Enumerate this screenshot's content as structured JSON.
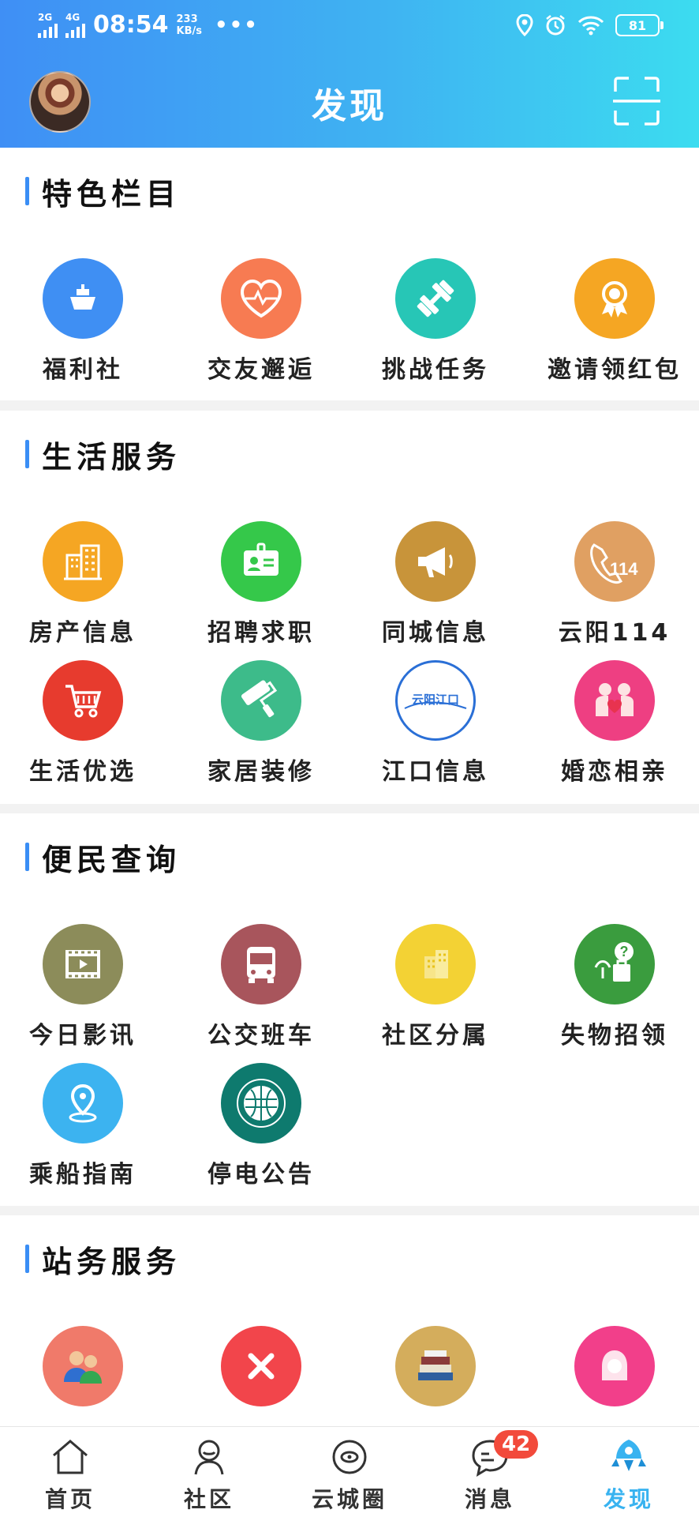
{
  "status_bar": {
    "net1": "2G",
    "net2": "4G",
    "time": "08:54",
    "speed_value": "233",
    "speed_unit": "KB/s",
    "battery": "81"
  },
  "header": {
    "title": "发现"
  },
  "sections": [
    {
      "title": "特色栏目",
      "items": [
        {
          "label": "福利社",
          "icon": "ship-icon",
          "color": "#3f8ff3"
        },
        {
          "label": "交友邂逅",
          "icon": "heartbeat-icon",
          "color": "#f77b52"
        },
        {
          "label": "挑战任务",
          "icon": "dumbbell-icon",
          "color": "#27c6b6"
        },
        {
          "label": "邀请领红包",
          "icon": "medal-icon",
          "color": "#f5a623"
        }
      ]
    },
    {
      "title": "生活服务",
      "items": [
        {
          "label": "房产信息",
          "icon": "building-icon",
          "color": "#f5a623"
        },
        {
          "label": "招聘求职",
          "icon": "id-card-icon",
          "color": "#35c84a"
        },
        {
          "label": "同城信息",
          "icon": "megaphone-icon",
          "color": "#c8943a"
        },
        {
          "label": "云阳114",
          "icon": "phone-114-icon",
          "color": "#e0a062"
        },
        {
          "label": "生活优选",
          "icon": "shopping-cart-icon",
          "color": "#e73b2e"
        },
        {
          "label": "家居装修",
          "icon": "paint-roller-icon",
          "color": "#3dbb8a"
        },
        {
          "label": "江口信息",
          "icon": "jiangkou-logo-icon",
          "color": "#ffffff"
        },
        {
          "label": "婚恋相亲",
          "icon": "couple-heart-icon",
          "color": "#ee3f82"
        }
      ]
    },
    {
      "title": "便民查询",
      "items": [
        {
          "label": "今日影讯",
          "icon": "film-icon",
          "color": "#8c8c5a"
        },
        {
          "label": "公交班车",
          "icon": "bus-icon",
          "color": "#a8555c"
        },
        {
          "label": "社区分属",
          "icon": "community-building-icon",
          "color": "#f3d234"
        },
        {
          "label": "失物招领",
          "icon": "lost-found-icon",
          "color": "#3a9c3e"
        },
        {
          "label": "乘船指南",
          "icon": "location-pin-icon",
          "color": "#3cb3f0"
        },
        {
          "label": "停电公告",
          "icon": "state-grid-logo-icon",
          "color": "#0e7a6e"
        }
      ]
    },
    {
      "title": "站务服务",
      "items": [
        {
          "label": "",
          "icon": "users-icon",
          "color": "#f07a6a"
        },
        {
          "label": "",
          "icon": "close-icon",
          "color": "#f2454b"
        },
        {
          "label": "",
          "icon": "books-icon",
          "color": "#d4ad5c"
        },
        {
          "label": "",
          "icon": "female-avatar-icon",
          "color": "#f23f8a"
        }
      ]
    }
  ],
  "tabbar": {
    "items": [
      {
        "label": "首页",
        "icon": "home-icon"
      },
      {
        "label": "社区",
        "icon": "community-icon"
      },
      {
        "label": "云城圈",
        "icon": "planet-icon"
      },
      {
        "label": "消息",
        "icon": "message-icon",
        "badge": "42"
      },
      {
        "label": "发现",
        "icon": "rocket-icon",
        "active": true
      }
    ]
  }
}
